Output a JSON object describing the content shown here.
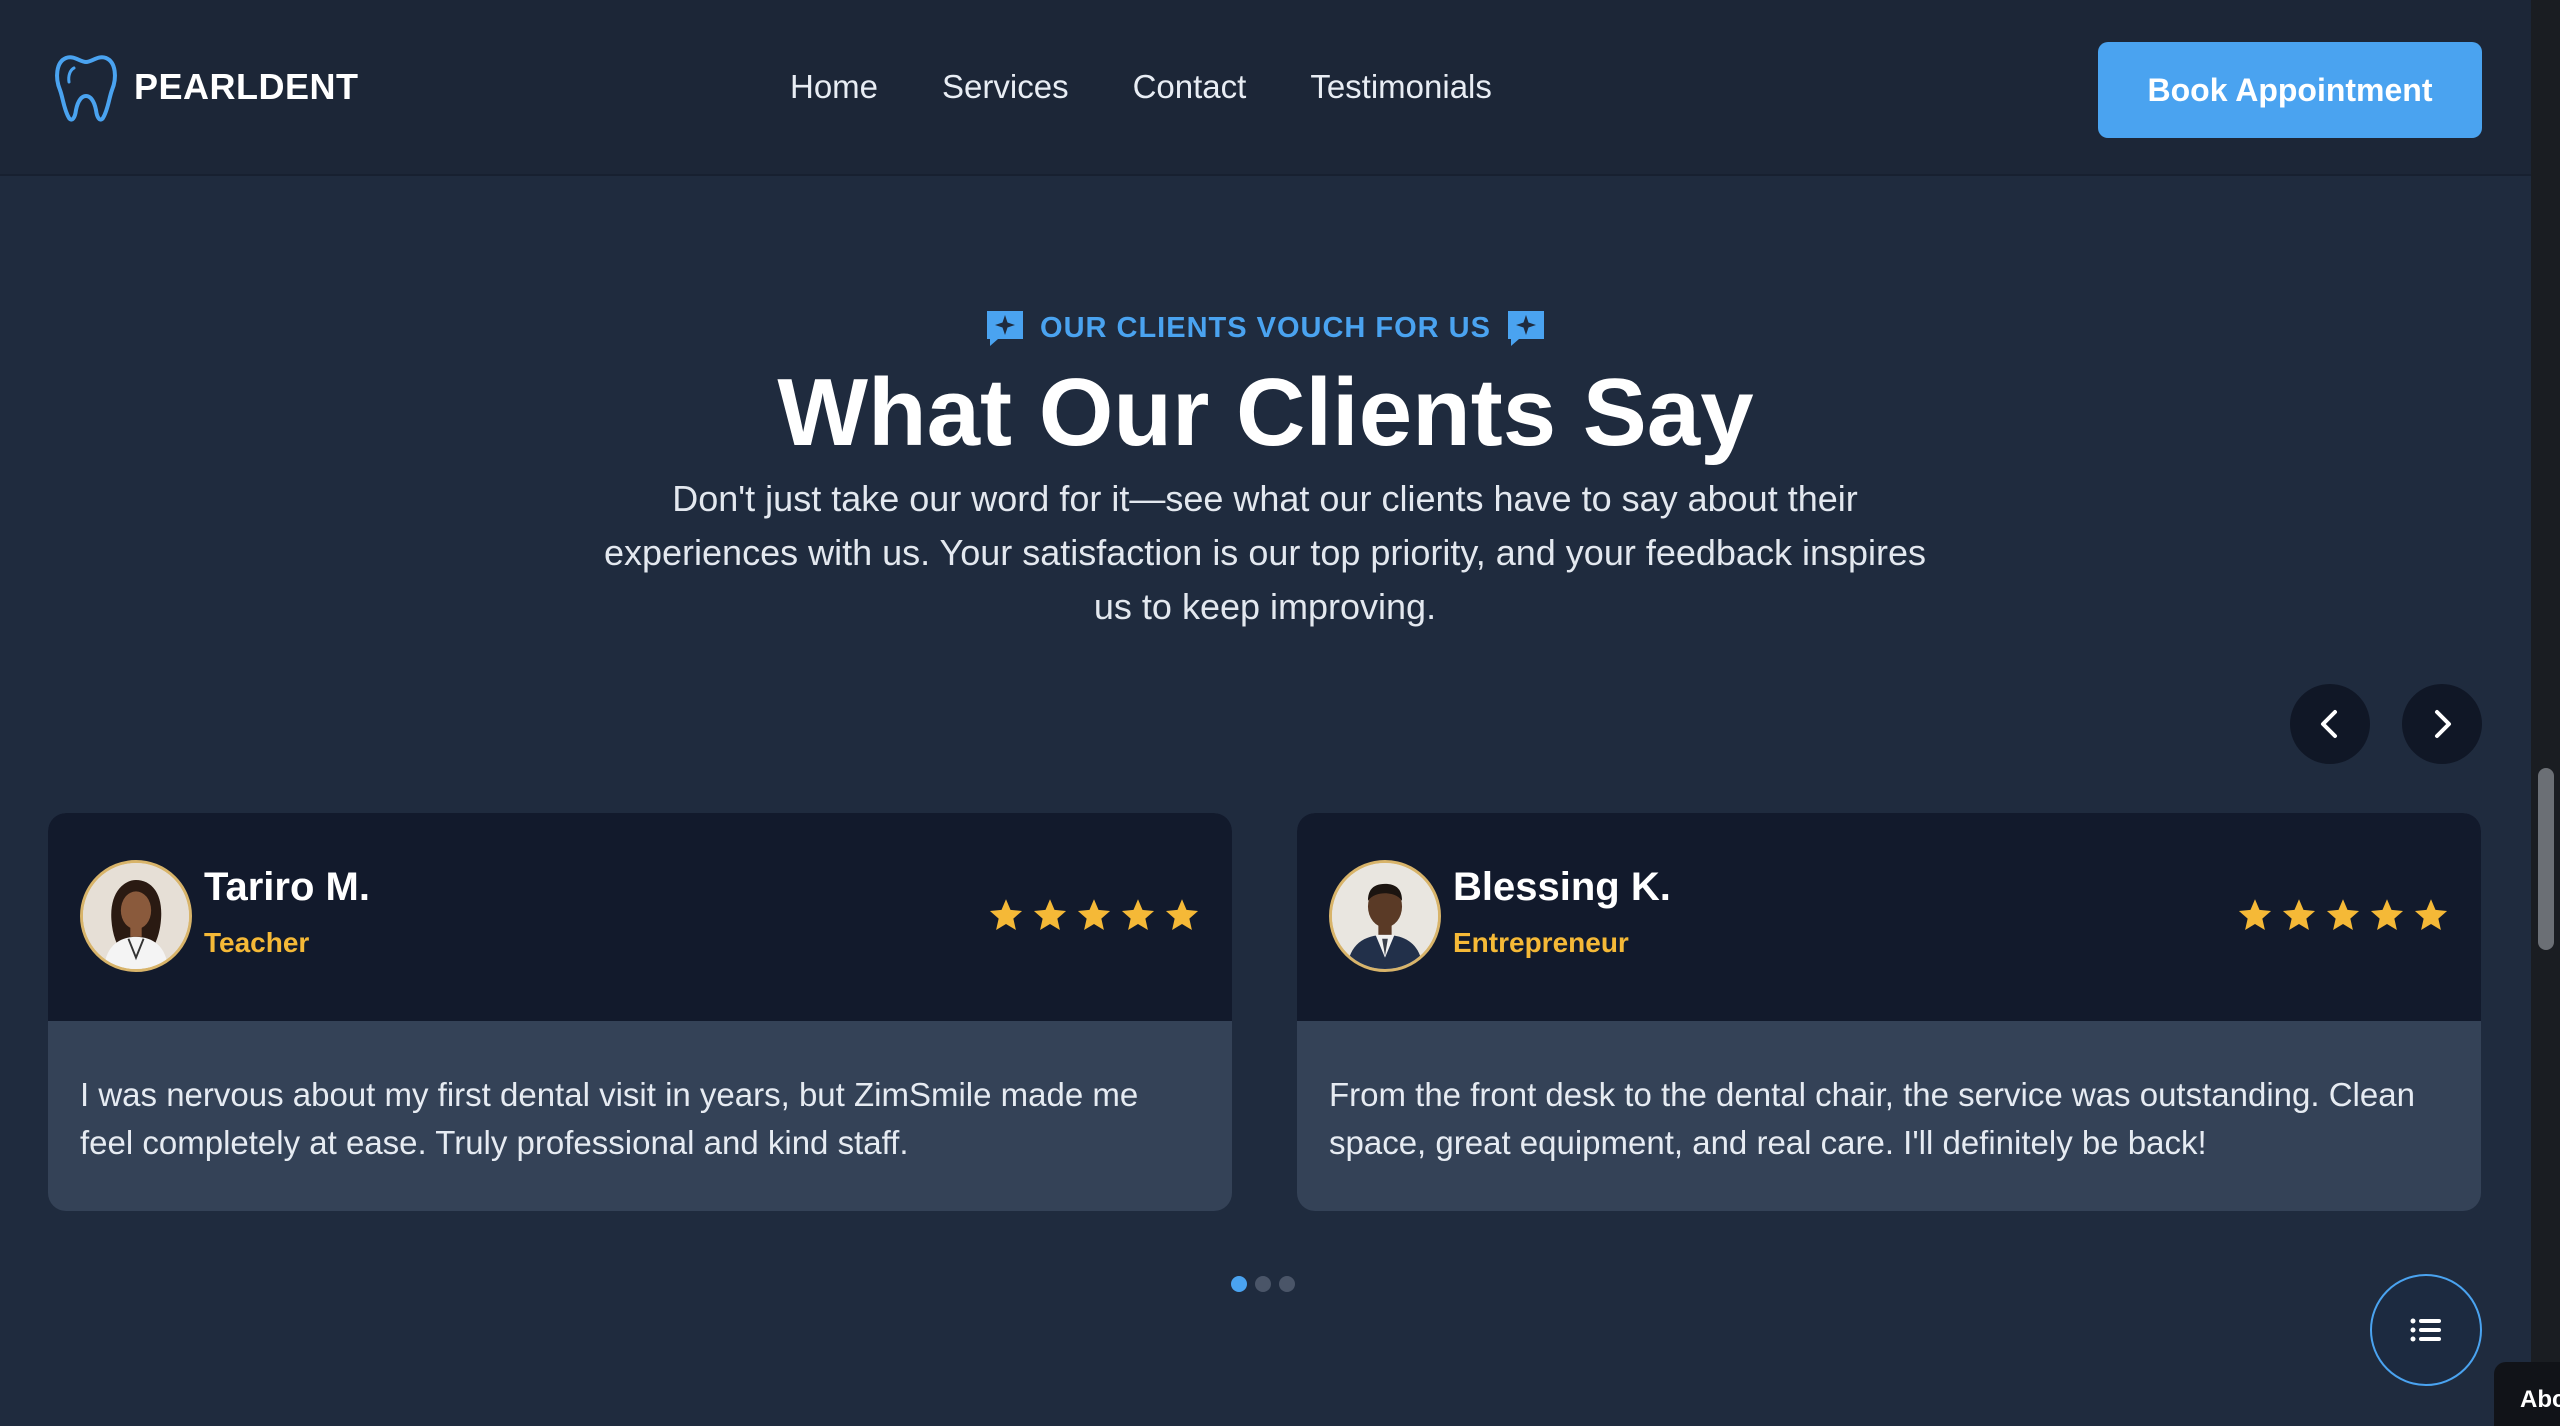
{
  "brand": {
    "name": "PEARLDENT",
    "logo_icon": "tooth-icon",
    "accent": "#4aa3f0"
  },
  "nav": {
    "items": [
      "Home",
      "Services",
      "Contact",
      "Testimonials"
    ]
  },
  "header": {
    "cta_label": "Book Appointment"
  },
  "section": {
    "eyebrow": "OUR CLIENTS VOUCH FOR US",
    "eyebrow_icon": "sparkle-chat-icon",
    "title": "What Our Clients Say",
    "subtitle": "Don't just take our word for it—see what our clients have to say about their experiences with us. Your satisfaction is our top priority, and your feedback inspires us to keep improving."
  },
  "carousel": {
    "prev_icon": "chevron-left-icon",
    "next_icon": "chevron-right-icon",
    "page_count": 3,
    "active_page": 1
  },
  "testimonials": [
    {
      "name": "Tariro M.",
      "role": "Teacher",
      "rating": 5,
      "text": "I was nervous about my first dental visit in years, but ZimSmile made me feel completely at ease. Truly professional and kind staff."
    },
    {
      "name": "Blessing K.",
      "role": "Entrepreneur",
      "rating": 5,
      "text": "From the front desk to the dental chair, the service was outstanding. Clean space, great equipment, and real care. I'll definitely be back!"
    }
  ],
  "fab": {
    "icon": "list-menu-icon"
  },
  "corner_widget": {
    "label": "Abc"
  },
  "colors": {
    "star": "#f5b937",
    "role": "#f5b937",
    "card_head": "#121a2c",
    "card_body": "#344257"
  }
}
